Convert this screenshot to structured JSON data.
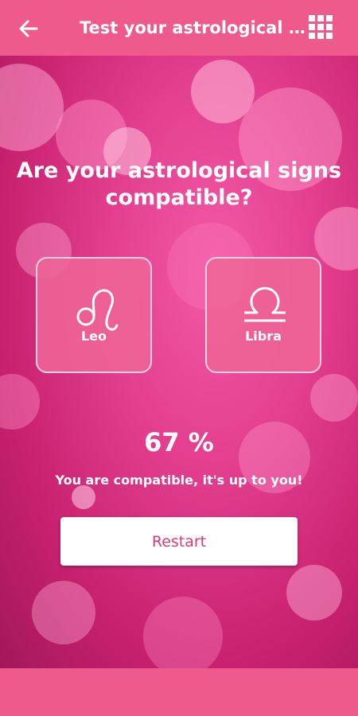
{
  "header": {
    "title": "Test your astrological signs compatibility",
    "back_icon": "back-arrow-icon",
    "menu_icon": "grid-menu-icon"
  },
  "main": {
    "question": "Are your astrological signs compatible?",
    "signs": [
      {
        "label": "Leo",
        "icon": "leo-symbol-icon"
      },
      {
        "label": "Libra",
        "icon": "libra-symbol-icon"
      }
    ],
    "percent": "67 %",
    "message": "You are compatible, it's up to you!",
    "restart_label": "Restart"
  },
  "colors": {
    "header_bg": "#ee5a8c",
    "accent_text": "#d93c75",
    "card_bg": "#ee6496",
    "background": "#d8337a"
  }
}
